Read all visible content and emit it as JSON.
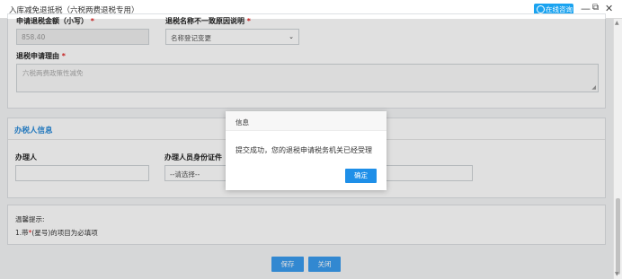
{
  "window": {
    "title": "入库减免退抵税（六税两费退税专用）",
    "consult_label": "在线咨询",
    "minimize_glyph": "—",
    "restore_glyph": "⧉",
    "close_glyph": "✕"
  },
  "form": {
    "refund_amount_label": "申请退税金额（小写）",
    "refund_amount_value": "858.40",
    "reason_type_label": "退税名称不一致原因说明",
    "reason_type_value": "名称登记变更",
    "refund_reason_label": "退税申请理由",
    "refund_reason_value": "六税两费政策性减免",
    "required_mark": "*"
  },
  "handler": {
    "section_title": "办税人信息",
    "handler_label": "办理人",
    "handler_value": "",
    "id_type_label": "办理人员身份证件",
    "id_type_value": "--请选择--",
    "id_no_value": ""
  },
  "tips": {
    "title": "温馨提示:",
    "line1_prefix": "1.带",
    "line1_star": "*",
    "line1_suffix": "(星号)的项目为必填项"
  },
  "actions": {
    "save_label": "保存",
    "close_label": "关闭"
  },
  "dialog": {
    "title": "信息",
    "message": "提交成功，您的退税申请税务机关已经受理",
    "ok_label": "确定"
  },
  "colors": {
    "accent": "#1e8fe8",
    "required": "#e02020",
    "section_title": "#2a8ad8"
  }
}
